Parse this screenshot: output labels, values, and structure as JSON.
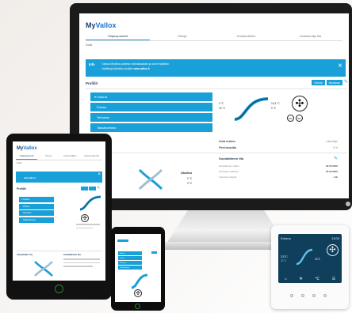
{
  "monitor": {
    "logo_my": "My",
    "logo_vallox": "Vallox",
    "tabs": [
      "Ohjauspaneeli",
      "Tietoja",
      "Huoltovalikko",
      "Asiantuntija tila"
    ],
    "breadcrumb": "Kotisi",
    "info_label": "Info",
    "info_text_1": "Tutustu MyVallox-palvelun ominaisuuksiin ja ota ne käyttöön",
    "info_text_2": "Lisätietoja MyVallox-sivuilta:",
    "info_link": "www.vallox.fi",
    "profile_title": "Profiilit",
    "profile_buttons": [
      "Vaihda",
      "Muokkaa"
    ],
    "profiles": [
      "Kotona",
      "Poissa",
      "Tehostus",
      "Takkatoiminto"
    ],
    "temps": {
      "left_top": "0 °C",
      "left_bottom": "16 °C",
      "right_top": "16,3 °C",
      "right_bottom": "0 °C"
    },
    "fan_badges": [
      "0%",
      "0%"
    ],
    "status_labels": [
      "Kotisi kosteus",
      "Pieni lampötila"
    ],
    "status_values": [
      "Lämmitys",
      "0 %"
    ],
    "next_title": "Suodattimen tila",
    "next_rows": [
      {
        "label": "Suodattimen vaihto",
        "value": "00.00.0000"
      },
      {
        "label": "Seuraava tarkistus",
        "value": "00.00.0000"
      },
      {
        "label": "Vuotuinen käyttö",
        "value": "1 kk"
      }
    ],
    "bottom_left": "Ulkoilma",
    "bottom_temps": [
      "0 °C",
      "0 °C"
    ]
  },
  "tablet": {
    "logo_my": "My",
    "logo_vallox": "Vallox",
    "tabs": [
      "Ohjauspaneeli",
      "Tietoja",
      "Huoltovalikko",
      "Asiantuntija tila"
    ],
    "breadcrumb": "Kotisi",
    "info_link": "www.vallox.fi",
    "profile_title": "Profiilit",
    "profiles": [
      "Kotona",
      "Poissa",
      "Tehostus",
      "Takkatoiminto"
    ],
    "left_section": "Lämpötilat (°C)",
    "right_section": "Suodattimen tila"
  },
  "phone": {
    "profiles": [
      "Kotona",
      "Poissa",
      "Tehostus",
      "Takkatoiminto"
    ]
  },
  "thermostat": {
    "label": "Kotona",
    "time": "13:00",
    "temp_left": "23°C",
    "temp_left_sub": "21°C",
    "temp_right": "23°C",
    "icons": [
      "house-icon",
      "fan-icon",
      "thermometer-icon",
      "menu-icon"
    ]
  },
  "colors": {
    "accent": "#19a0d8",
    "brand_dark": "#1a3e66",
    "therm_screen": "#0f3f5a"
  }
}
